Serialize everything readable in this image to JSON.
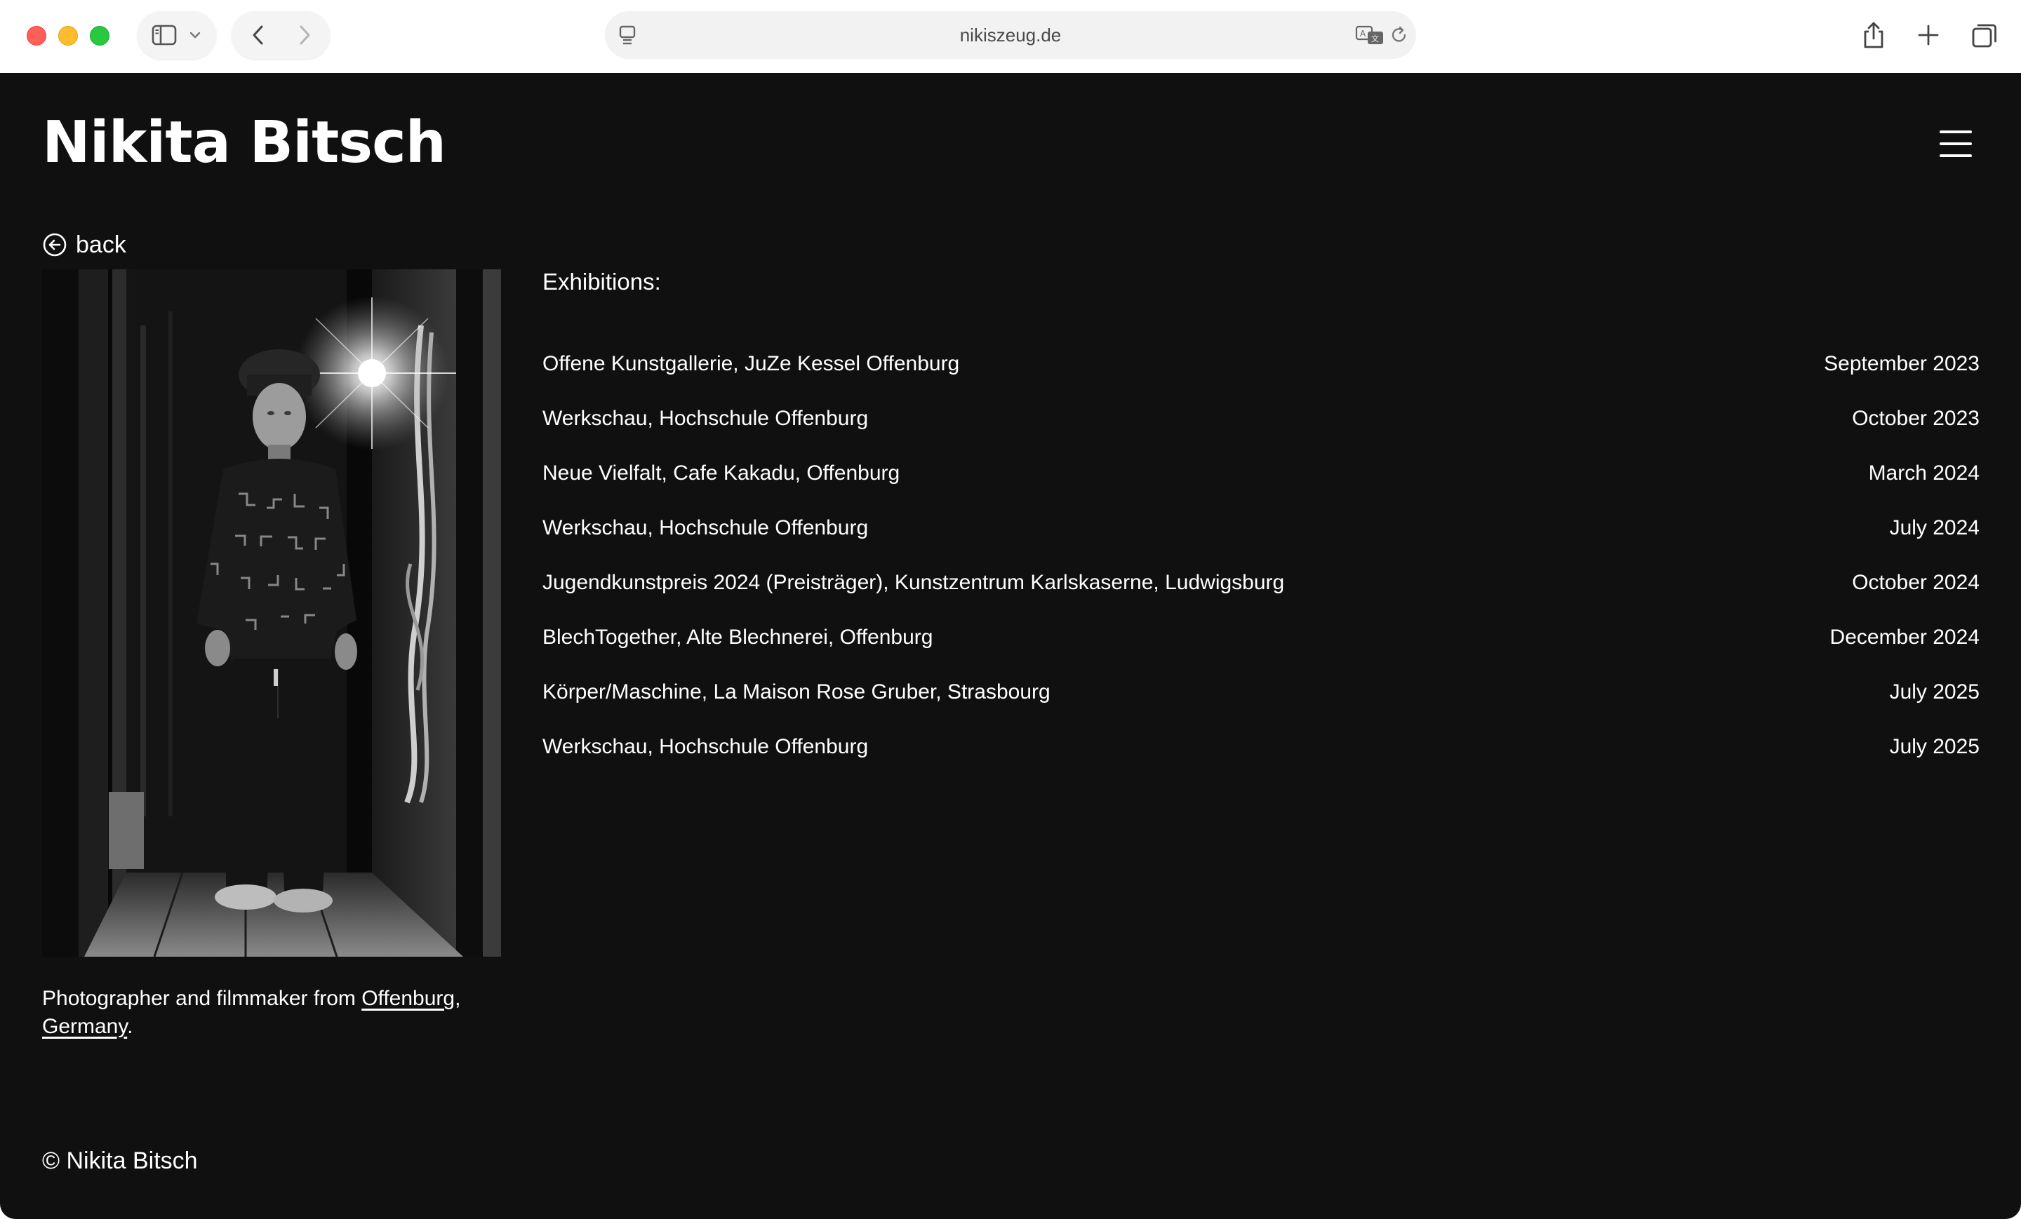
{
  "browser": {
    "url": "nikiszeug.de",
    "icons": {
      "sidebar": "sidebar-icon",
      "chevron": "chevron-down-icon",
      "back": "back-arrow-icon",
      "forward": "forward-arrow-icon",
      "page_menu": "page-menu-icon",
      "translate": "translate-icon",
      "reload": "reload-icon",
      "share": "share-icon",
      "new_tab": "plus-icon",
      "tabs": "tab-overview-icon"
    }
  },
  "site": {
    "title": "Nikita Bitsch",
    "menu_icon": "hamburger-menu-icon"
  },
  "back": {
    "label": "back"
  },
  "bio": {
    "text_before": "Photographer and filmmaker from ",
    "link_city": "Offenburg",
    "separator": ",",
    "link_country": "Germany",
    "text_after": "."
  },
  "exhibitions": {
    "heading": "Exhibitions:",
    "items": [
      {
        "name": "Offene Kunstgallerie, JuZe Kessel Offenburg",
        "date": "September 2023"
      },
      {
        "name": "Werkschau, Hochschule Offenburg",
        "date": "October 2023"
      },
      {
        "name": "Neue Vielfalt, Cafe Kakadu, Offenburg",
        "date": "March 2024"
      },
      {
        "name": "Werkschau, Hochschule Offenburg",
        "date": "July 2024"
      },
      {
        "name": "Jugendkunstpreis 2024 (Preisträger), Kunstzentrum Karlskaserne, Ludwigsburg",
        "date": "October 2024"
      },
      {
        "name": "BlechTogether, Alte Blechnerei, Offenburg",
        "date": "December 2024"
      },
      {
        "name": "Körper/Maschine, La Maison Rose Gruber, Strasbourg",
        "date": "July 2025"
      },
      {
        "name": "Werkschau, Hochschule Offenburg",
        "date": "July 2025"
      }
    ]
  },
  "footer": {
    "copyright": "© Nikita Bitsch"
  }
}
